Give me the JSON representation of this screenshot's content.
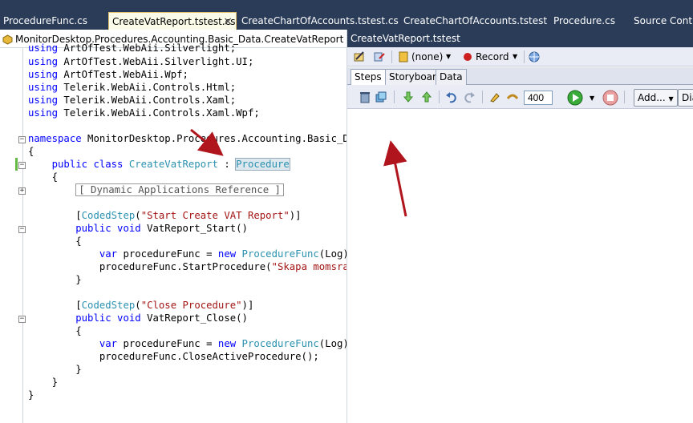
{
  "tabs": [
    {
      "label": "ProcedureFunc.cs",
      "active": false
    },
    {
      "label": "CreateVatReport.tstest.cs",
      "active": true
    },
    {
      "label": "CreateChartOfAccounts.tstest.cs",
      "active": false
    },
    {
      "label": "CreateChartOfAccounts.tstest",
      "active": false
    },
    {
      "label": "Procedure.cs",
      "active": false
    },
    {
      "label": "Source Contro",
      "active": false
    }
  ],
  "tab_close_glyph": "×",
  "editor": {
    "nav_path": "MonitorDesktop.Procedures.Accounting.Basic_Data.CreateVatReport",
    "lines": [
      {
        "k": "using",
        "t": " ArtOfTest.WebAii.Silverlight;"
      },
      {
        "k": "using",
        "t": " ArtOfTest.WebAii.Silverlight.UI;"
      },
      {
        "k": "using",
        "t": " ArtOfTest.WebAii.Wpf;"
      },
      {
        "k": "using",
        "t": " Telerik.WebAii.Controls.Html;"
      },
      {
        "k": "using",
        "t": " Telerik.WebAii.Controls.Xaml;"
      },
      {
        "k": "using",
        "t": " Telerik.WebAii.Controls.Xaml.Wpf;"
      }
    ],
    "namespace_kw": "namespace",
    "namespace_name": " MonitorDesktop.Procedures.Accounting.Basic_Data",
    "open_brace": "{",
    "close_brace": "}",
    "class_mods": "public class",
    "class_name": "CreateVatReport",
    "class_colon": " : ",
    "class_base": "Procedure",
    "region_label": "Dynamic Applications Reference",
    "attr1_name": "CodedStep",
    "attr1_arg": "\"Start Create VAT Report\"",
    "method1_mods": "public void",
    "method1_name": " VatReport_Start()",
    "var_kw": "var",
    "var_name": " procedureFunc = ",
    "new_kw": "new",
    "ctor_type": "ProcedureFunc",
    "ctor_args": "(Log);",
    "call1": "procedureFunc.StartProcedure(",
    "call1_arg": "\"Skapa momsrappo",
    "attr2_name": "CodedStep",
    "attr2_arg": "\"Close Procedure\"",
    "method2_mods": "public void",
    "method2_name": " VatReport_Close()",
    "call2": "procedureFunc.CloseActiveProcedure();"
  },
  "test_pane": {
    "title": "CreateVatReport.tstest",
    "browser_value": "(none)",
    "record_label": "Record",
    "subtabs": [
      "Steps",
      "Storyboard",
      "Data"
    ],
    "delay_value": "400",
    "add_label": "Add...",
    "dia_label": "Dia"
  },
  "colors": {
    "annotation_arrow": "#b0141c",
    "accent": "#2b3c59"
  }
}
